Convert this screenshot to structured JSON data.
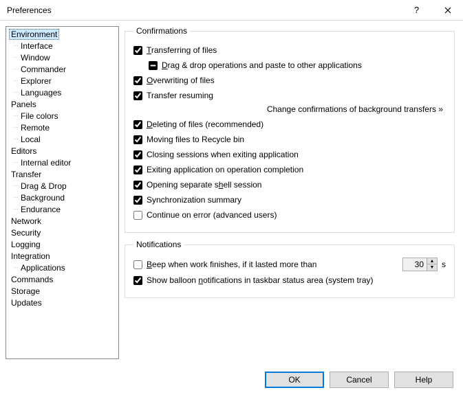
{
  "window": {
    "title": "Preferences"
  },
  "tree": [
    {
      "label": "Environment",
      "selected": true
    },
    {
      "label": "Interface",
      "child": true
    },
    {
      "label": "Window",
      "child": true
    },
    {
      "label": "Commander",
      "child": true
    },
    {
      "label": "Explorer",
      "child": true
    },
    {
      "label": "Languages",
      "child": true
    },
    {
      "label": "Panels"
    },
    {
      "label": "File colors",
      "child": true
    },
    {
      "label": "Remote",
      "child": true
    },
    {
      "label": "Local",
      "child": true
    },
    {
      "label": "Editors"
    },
    {
      "label": "Internal editor",
      "child": true
    },
    {
      "label": "Transfer"
    },
    {
      "label": "Drag & Drop",
      "child": true
    },
    {
      "label": "Background",
      "child": true
    },
    {
      "label": "Endurance",
      "child": true
    },
    {
      "label": "Network"
    },
    {
      "label": "Security"
    },
    {
      "label": "Logging"
    },
    {
      "label": "Integration"
    },
    {
      "label": "Applications",
      "child": true
    },
    {
      "label": "Commands"
    },
    {
      "label": "Storage"
    },
    {
      "label": "Updates"
    }
  ],
  "confirmations": {
    "legend": "Confirmations",
    "transferring": {
      "label": "Transferring of files",
      "u": "T",
      "checked": true
    },
    "dragdrop": {
      "label": "Drag & drop operations and paste to other applications",
      "u": "D",
      "checked": "mixed"
    },
    "overwriting": {
      "label": "Overwriting of files",
      "u": "O",
      "checked": true
    },
    "resuming": {
      "label": "Transfer resuming",
      "checked": true
    },
    "bglink": "Change confirmations of background transfers »",
    "deleting": {
      "label": "Deleting of files (recommended)",
      "u": "D",
      "checked": true
    },
    "recycle": {
      "label": "Moving files to Recycle bin",
      "checked": true
    },
    "closing": {
      "label": "Closing sessions when exiting application",
      "checked": true
    },
    "exiting": {
      "label": "Exiting application on operation completion",
      "checked": true
    },
    "shell": {
      "label": "Opening separate shell session",
      "u": "h",
      "checked": true
    },
    "sync": {
      "label": "Synchronization summary",
      "checked": true
    },
    "continue": {
      "label": "Continue on error (advanced users)",
      "checked": false
    }
  },
  "notifications": {
    "legend": "Notifications",
    "beep": {
      "label": "Beep when work finishes, if it lasted more than",
      "u": "B",
      "checked": false,
      "value": "30",
      "unit": "s"
    },
    "balloon": {
      "label": "Show balloon notifications in taskbar status area (system tray)",
      "u": "n",
      "checked": true
    }
  },
  "buttons": {
    "ok": "OK",
    "cancel": "Cancel",
    "help": "Help"
  }
}
